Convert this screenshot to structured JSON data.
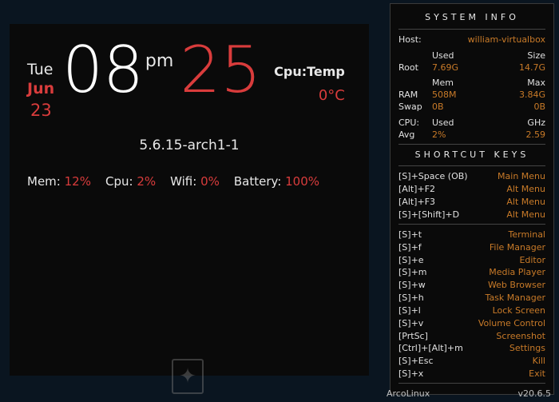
{
  "clock": {
    "weekday": "Tue",
    "month": "Jun",
    "mday": "23",
    "hour": "08",
    "ampm": "pm",
    "minute": "25"
  },
  "cpu_temp": {
    "label": "Cpu:Temp",
    "value": "0°C"
  },
  "kernel": "5.6.15-arch1-1",
  "stats": {
    "mem": {
      "label": "Mem:",
      "value": "12%"
    },
    "cpu": {
      "label": "Cpu:",
      "value": "2%"
    },
    "wifi": {
      "label": "Wifi:",
      "value": "0%"
    },
    "battery": {
      "label": "Battery:",
      "value": "100%"
    }
  },
  "sysinfo": {
    "title": "SYSTEM INFO",
    "host_label": "Host:",
    "host_value": "william-virtualbox",
    "root": {
      "label": "Root",
      "used_label": "Used",
      "used": "7.69G",
      "size_label": "Size",
      "size": "14.7G"
    },
    "ram": {
      "label": "RAM",
      "mem_label": "Mem",
      "mem": "508M",
      "max_label": "Max",
      "max": "3.84G"
    },
    "swap": {
      "label": "Swap",
      "used": "0B",
      "max": "0B"
    },
    "cpu": {
      "label": "CPU:",
      "used_label": "Used",
      "ghz_label": "GHz",
      "avg_label": "Avg",
      "used": "2%",
      "ghz": "2.59"
    }
  },
  "shortcuts": {
    "title": "SHORTCUT KEYS",
    "group1": [
      {
        "key": "[S]+Space (OB)",
        "action": "Main Menu"
      },
      {
        "key": "[Alt]+F2",
        "action": "Alt Menu"
      },
      {
        "key": "[Alt]+F3",
        "action": "Alt Menu"
      },
      {
        "key": "[S]+[Shift]+D",
        "action": "Alt Menu"
      }
    ],
    "group2": [
      {
        "key": "[S]+t",
        "action": "Terminal"
      },
      {
        "key": "[S]+f",
        "action": "File Manager"
      },
      {
        "key": "[S]+e",
        "action": "Editor"
      },
      {
        "key": "[S]+m",
        "action": "Media Player"
      },
      {
        "key": "[S]+w",
        "action": "Web Browser"
      },
      {
        "key": "[S]+h",
        "action": "Task Manager"
      },
      {
        "key": "[S]+l",
        "action": "Lock Screen"
      },
      {
        "key": "[S]+v",
        "action": "Volume Control"
      },
      {
        "key": "[PrtSc]",
        "action": "Screenshot"
      },
      {
        "key": "[Ctrl]+[Alt]+m",
        "action": "Settings"
      },
      {
        "key": "[S]+Esc",
        "action": "Kill"
      },
      {
        "key": "[S]+x",
        "action": "Exit"
      }
    ]
  },
  "footer": {
    "distro": "ArcoLinux",
    "version": "v20.6.5"
  }
}
